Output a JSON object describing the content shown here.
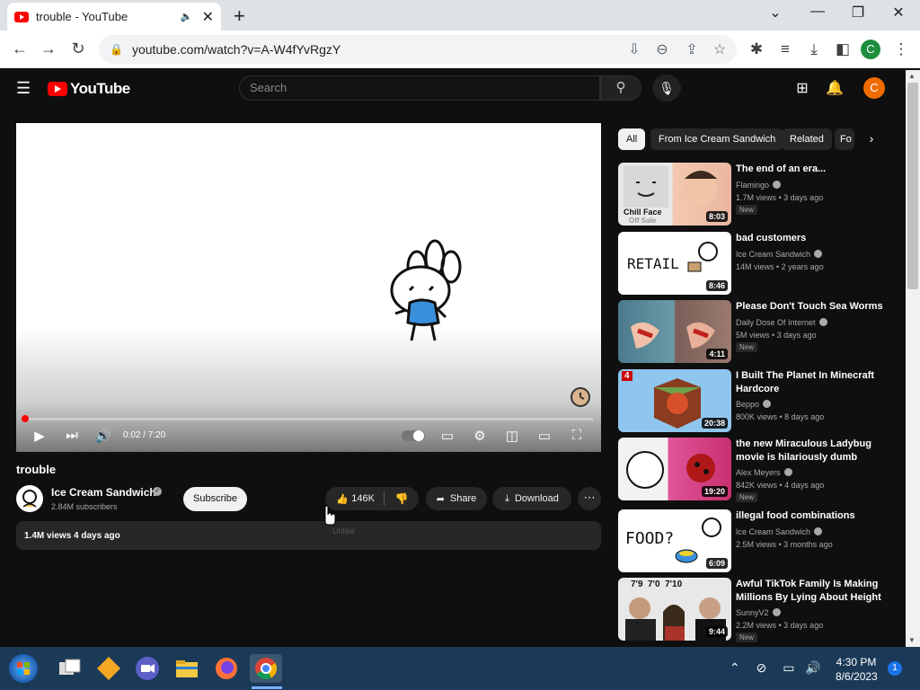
{
  "browser": {
    "tab_title": "trouble - YouTube",
    "url": "youtube.com/watch?v=A-W4fYvRgzY",
    "profile_initial": "C"
  },
  "header": {
    "logo_text": "YouTube",
    "search_placeholder": "Search",
    "avatar_initial": "C"
  },
  "video": {
    "time": "0:02 / 7:20",
    "progress_fraction": 0.005,
    "title": "trouble",
    "channel": "Ice Cream Sandwich",
    "subscribers": "2.84M subscribers",
    "subscribe_label": "Subscribe",
    "likes": "146K",
    "share_label": "Share",
    "download_label": "Download",
    "views_date": "1.4M views  4 days ago",
    "tooltip": "Unlike"
  },
  "chips": [
    "All",
    "From Ice Cream Sandwich",
    "Related",
    "Fo"
  ],
  "recommendations": [
    {
      "title": "The end of an era...",
      "channel": "Flamingo",
      "meta": "1.7M views • 3 days ago",
      "badge": "New",
      "duration": "8:03",
      "thumb_text": "Chill Face",
      "thumb_sub": "Off Sale"
    },
    {
      "title": "bad customers",
      "channel": "Ice Cream Sandwich",
      "meta": "14M views • 2 years ago",
      "badge": "",
      "duration": "8:46",
      "thumb_text": "RETAIL"
    },
    {
      "title": "Please Don't Touch Sea Worms",
      "channel": "Daily Dose Of Internet",
      "meta": "5M views • 3 days ago",
      "badge": "New",
      "duration": "4:11"
    },
    {
      "title": "I Built The Planet In Minecraft Hardcore",
      "channel": "Beppo",
      "meta": "800K views • 8 days ago",
      "badge": "",
      "duration": "20:38",
      "thumb_text": "4"
    },
    {
      "title": "the new Miraculous Ladybug movie is hilariously dumb",
      "channel": "Alex Meyers",
      "meta": "842K views • 4 days ago",
      "badge": "New",
      "duration": "19:20"
    },
    {
      "title": "illegal food combinations",
      "channel": "Ice Cream Sandwich",
      "meta": "2.5M views • 3 months ago",
      "badge": "",
      "duration": "6:09",
      "thumb_text": "FOOD?"
    },
    {
      "title": "Awful TikTok Family Is Making Millions By Lying About Height",
      "channel": "SunnyV2",
      "meta": "2.2M views • 3 days ago",
      "badge": "New",
      "duration": "9:44",
      "thumb_text": "7'9  7'0  7'10"
    }
  ],
  "taskbar": {
    "time": "4:30 PM",
    "date": "8/6/2023",
    "notifications": "1"
  }
}
